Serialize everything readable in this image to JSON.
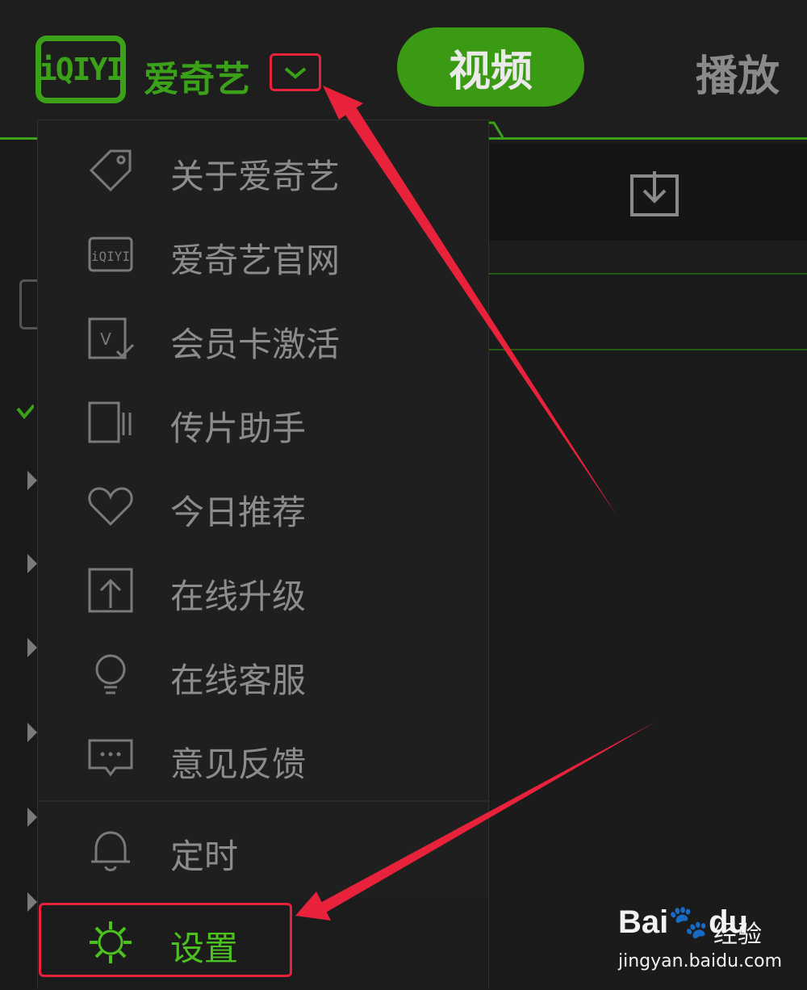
{
  "header": {
    "logo_text": "iQIYI",
    "brand": "爱奇艺",
    "tabs": [
      {
        "label": "视频",
        "active": true
      },
      {
        "label": "播放"
      }
    ],
    "accent_color": "#3aa118"
  },
  "menu": {
    "items": [
      {
        "label": "关于爱奇艺",
        "icon": "tag-icon"
      },
      {
        "label": "爱奇艺官网",
        "icon": "iqiyi-logo-icon"
      },
      {
        "label": "会员卡激活",
        "icon": "vip-card-check-icon"
      },
      {
        "label": "传片助手",
        "icon": "upload-assistant-icon"
      },
      {
        "label": "今日推荐",
        "icon": "heart-icon"
      },
      {
        "label": "在线升级",
        "icon": "upgrade-arrow-icon"
      },
      {
        "label": "在线客服",
        "icon": "lightbulb-icon"
      },
      {
        "label": "意见反馈",
        "icon": "chat-bubble-icon"
      },
      {
        "label": "定时",
        "icon": "bell-icon"
      },
      {
        "label": "设置",
        "icon": "gear-icon",
        "active": true
      }
    ]
  },
  "watermark": {
    "brand": "Bai",
    "brand_suffix": "du",
    "product": "经验",
    "url": "jingyan.baidu.com"
  }
}
